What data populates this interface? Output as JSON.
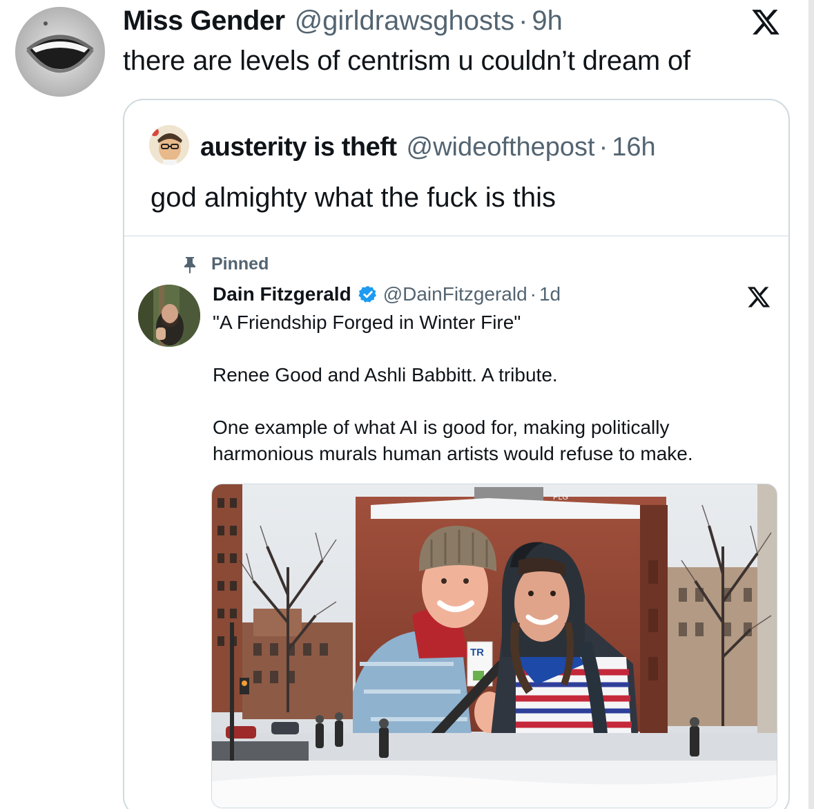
{
  "outer_tweet": {
    "display_name": "Miss Gender",
    "handle": "@girldrawsghosts",
    "separator": "·",
    "time": "9h",
    "text": "there are levels of centrism u couldn’t dream of"
  },
  "quoted_tweet": {
    "display_name": "austerity is theft",
    "handle": "@wideofthepost",
    "separator": "·",
    "time": "16h",
    "text": "god almighty what the fuck is this"
  },
  "embedded_tweet": {
    "pinned_label": "Pinned",
    "display_name": "Dain Fitzgerald",
    "handle": "@DainFitzgerald",
    "separator": "·",
    "time": "1d",
    "title_line": "\"A Friendship Forged in Winter Fire\"",
    "paragraph_1": "Renee Good and Ashli Babbitt. A tribute.",
    "paragraph_2_line_1": "One example of what AI is good for, making politically",
    "paragraph_2_line_2": "harmonious murals human artists would refuse to make."
  },
  "image_signs": {
    "roof_sign": "PLG",
    "held_card": "TR"
  },
  "icons": {
    "platform_logo": "x-logo-icon",
    "pin": "pin-icon",
    "verified": "verified-badge-icon"
  },
  "colors": {
    "text_primary": "#0f1419",
    "text_secondary": "#536471",
    "border": "#cfd9de",
    "verified_blue": "#1d9bf0"
  }
}
